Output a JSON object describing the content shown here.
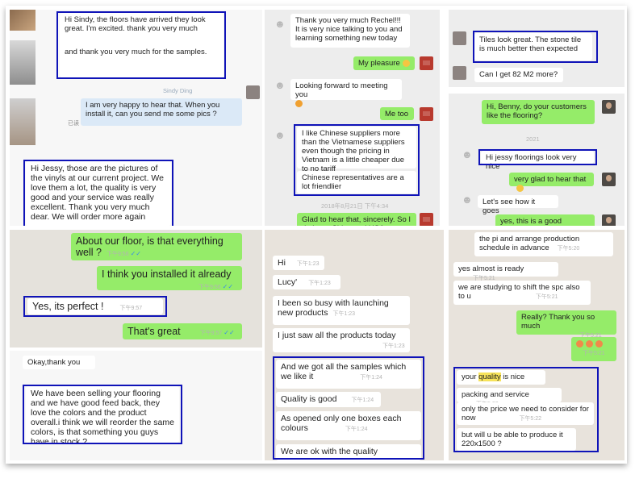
{
  "p1": {
    "sender_name": "Sindy Ding",
    "m1": "Hi Sindy, the floors have arrived  they look great. I'm excited.  thank you very much",
    "m1b": "and thank you very much for the samples.",
    "m2": "I am very happy to hear that. When you install it, can you send me some pics ?",
    "m2_tag": "已读",
    "m3": "Hi Jessy, those are the pictures of the vinyls at our current project. We love them a lot, the quality is very good and your service was really excellent. Thank you very much dear. We will order more again"
  },
  "p2": {
    "m1": "Thank you very much Rechel!!! It is very nice talking to you and learning something new today",
    "m2": "My pleasure",
    "m3": "Looking forward to meeting you",
    "m4": "Me too",
    "m5": "I like Chinese suppliers more than the Vietnamese suppliers even though the pricing in Vietnam is a little cheaper due to no tariff",
    "m6": "Chinese representatives are a lot friendlier",
    "time": "2018年8月21日 下午4:34",
    "m7": "Glad to hear that, sincerely. So I do hope China and USA can have"
  },
  "p3": {
    "m1": "Tiles look great. The stone tile is much better then expected",
    "m2": "Can I get 82 M2 more?"
  },
  "p4": {
    "m1": "Hi, Benny, do your customers like the flooring?",
    "time": "2021",
    "m2": "Hi jessy floorings look very nice",
    "m3": "very glad to hear that",
    "m4": "Let's see how it goes",
    "m5": "yes, this is a good begining"
  },
  "p5": {
    "m1": "About our floor, is that everything well ?",
    "t1": "下午9:56",
    "m2": "I think you installed it already",
    "t2": "下午9:56",
    "m3": "Yes, its perfect !",
    "t3": "下午9:57",
    "m4": "That's great",
    "t4": "下午9:57"
  },
  "p6": {
    "m1": "Okay,thank you",
    "m2": "We have been selling your flooring and we have good feed back, they love the colors and the  product overall.i think we will reorder the same colors, is that something you guys have in stock ?"
  },
  "p7": {
    "m1": "Hi",
    "t1": "下午1:23",
    "m2": "Lucy'",
    "t2": "下午1:23",
    "m3": "I been so busy with launching new products",
    "t3": "下午1:23",
    "m4": "I just saw all the products today",
    "t4": "下午1:23",
    "m5": "And we got all the samples which we like it",
    "t5": "下午1:24",
    "m6": "Quality is good",
    "t6": "下午1:24",
    "m7": "As opened only one boxes each colours",
    "t7": "下午1:24",
    "m8": "We are ok with the quality"
  },
  "p8": {
    "m1": "the pi and arrange production schedule in advance",
    "t1": "下午5:20",
    "m2": "yes almost is ready",
    "t2": "下午5:21",
    "m3": "we are studying to shift the spc also to u",
    "t3": "下午5:21",
    "m4": "Really? Thank you so much",
    "t4": "下午5:21",
    "t5": "下午5:21",
    "m6a": "your",
    "m6b": "quality",
    "m6c": " is nice",
    "t6": "下午5:22",
    "m7": "packing and service",
    "t7": "下午5:22",
    "m8": "only the price we need to consider for now",
    "t8": "下午5:22",
    "m9": "but will u be able to produce it 220x1500 ?"
  }
}
